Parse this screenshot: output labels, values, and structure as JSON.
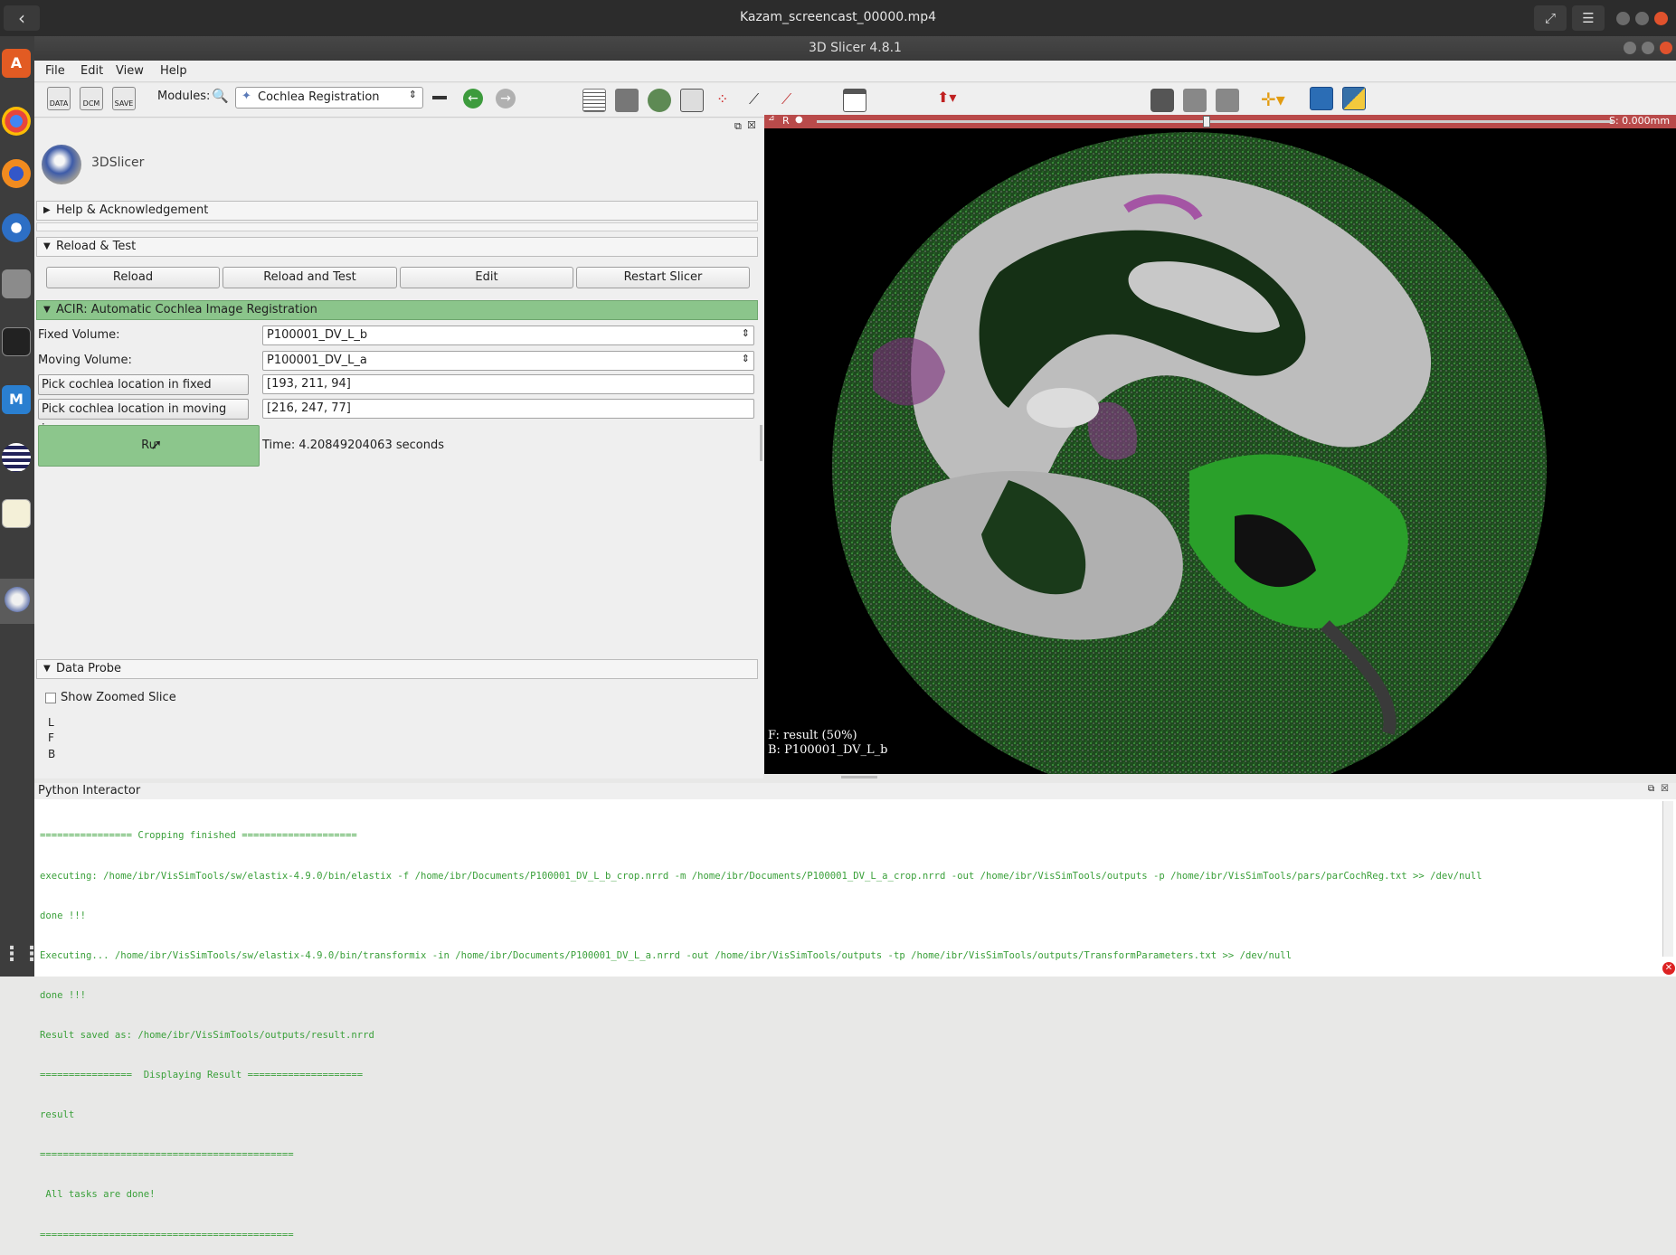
{
  "os": {
    "window_title": "Kazam_screencast_00000.mp4",
    "back": "‹",
    "fullscreen": "⤢",
    "menu": "☰"
  },
  "dock": {
    "items": [
      "A",
      "",
      "",
      "",
      "",
      "",
      "",
      "M",
      "",
      "",
      "",
      ""
    ]
  },
  "app": {
    "title": "3D Slicer 4.8.1",
    "logo_text": "3DSlicer"
  },
  "menubar": [
    "File",
    "Edit",
    "View",
    "Help"
  ],
  "toolbar": {
    "modules_label": "Modules:",
    "module": "Cochlea Registration",
    "icons": [
      "DATA",
      "DCM",
      "SAVE"
    ]
  },
  "sections": {
    "help": "Help & Acknowledgement",
    "reload": "Reload & Test",
    "acir": "ACIR: Automatic Cochlea Image Registration",
    "probe": "Data Probe"
  },
  "reload_buttons": [
    "Reload",
    "Reload and Test",
    "Edit",
    "Restart Slicer"
  ],
  "form": {
    "fixed_label": "Fixed Volume:",
    "fixed_value": "P100001_DV_L_b",
    "moving_label": "Moving Volume:",
    "moving_value": "P100001_DV_L_a",
    "pick_fixed": "Pick cochlea location in fixed image",
    "pick_fixed_value": "[193, 211, 94]",
    "pick_moving": "Pick cochlea location in moving image",
    "pick_moving_value": "[216, 247, 77]",
    "run": "Ru",
    "time": "Time: 4.20849204063  seconds"
  },
  "probe": {
    "show_zoomed": "Show Zoomed Slice",
    "l": "L",
    "f": "F",
    "b": "B"
  },
  "viewer": {
    "r": "R",
    "offset": "S: 0.000mm",
    "fg": "F: result (50%)",
    "bg": "B: P100001_DV_L_b",
    "offset_fraction": 0.49
  },
  "python": {
    "title": "Python Interactor",
    "lines": [
      "================ Cropping finished ====================",
      "executing: /home/ibr/VisSimTools/sw/elastix-4.9.0/bin/elastix -f /home/ibr/Documents/P100001_DV_L_b_crop.nrrd -m /home/ibr/Documents/P100001_DV_L_a_crop.nrrd -out /home/ibr/VisSimTools/outputs -p /home/ibr/VisSimTools/pars/parCochReg.txt >> /dev/null",
      "done !!!",
      "Executing... /home/ibr/VisSimTools/sw/elastix-4.9.0/bin/transformix -in /home/ibr/Documents/P100001_DV_L_a.nrrd -out /home/ibr/VisSimTools/outputs -tp /home/ibr/VisSimTools/outputs/TransformParameters.txt >> /dev/null",
      "done !!!",
      "Result saved as: /home/ibr/VisSimTools/outputs/result.nrrd",
      "================  Displaying Result ====================",
      "result",
      "============================================",
      " All tasks are done!",
      "============================================"
    ]
  }
}
